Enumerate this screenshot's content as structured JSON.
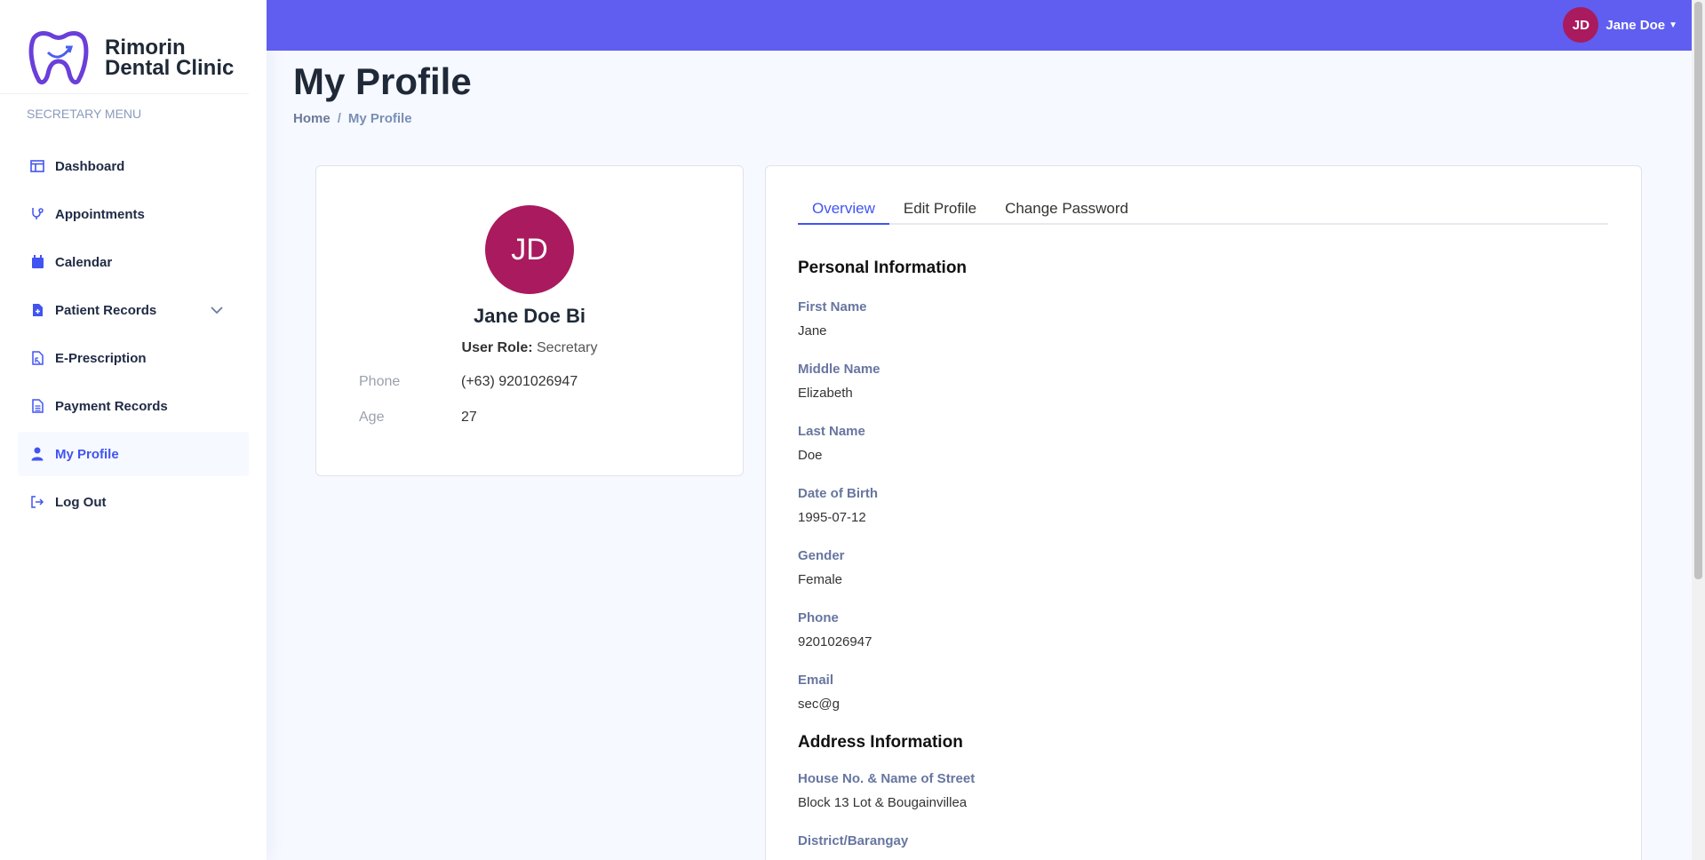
{
  "brand": {
    "name_line1": "Rimorin",
    "name_line2": "Dental Clinic",
    "accent": "#5f5ef0"
  },
  "sidebar": {
    "heading": "SECRETARY MENU",
    "items": [
      {
        "label": "Dashboard",
        "icon": "dashboard-icon"
      },
      {
        "label": "Appointments",
        "icon": "stethoscope-icon"
      },
      {
        "label": "Calendar",
        "icon": "calendar-icon"
      },
      {
        "label": "Patient Records",
        "icon": "file-medical-icon"
      },
      {
        "label": "E-Prescription",
        "icon": "prescription-icon"
      },
      {
        "label": "Payment Records",
        "icon": "receipt-icon"
      },
      {
        "label": "My Profile",
        "icon": "person-icon"
      },
      {
        "label": "Log Out",
        "icon": "logout-icon"
      }
    ]
  },
  "header": {
    "user_initials": "JD",
    "user_name": "Jane Doe"
  },
  "page": {
    "title": "My Profile",
    "breadcrumb_home": "Home",
    "breadcrumb_sep": "/",
    "breadcrumb_current": "My Profile"
  },
  "profile_card": {
    "initials": "JD",
    "name": "Jane Doe Bi",
    "role_label": "User Role:",
    "role_value": "Secretary",
    "phone_label": "Phone",
    "phone_value": "(+63) 9201026947",
    "age_label": "Age",
    "age_value": "27"
  },
  "tabs": [
    "Overview",
    "Edit Profile",
    "Change Password"
  ],
  "personal": {
    "title": "Personal Information",
    "fields": [
      {
        "label": "First Name",
        "value": "Jane"
      },
      {
        "label": "Middle Name",
        "value": "Elizabeth"
      },
      {
        "label": "Last Name",
        "value": "Doe"
      },
      {
        "label": "Date of Birth",
        "value": "1995-07-12"
      },
      {
        "label": "Gender",
        "value": "Female"
      },
      {
        "label": "Phone",
        "value": "9201026947"
      },
      {
        "label": "Email",
        "value": "sec@g"
      }
    ]
  },
  "address": {
    "title": "Address Information",
    "fields": [
      {
        "label": "House No. & Name of Street",
        "value": "Block 13 Lot & Bougainvillea"
      },
      {
        "label": "District/Barangay",
        "value": ""
      }
    ]
  }
}
